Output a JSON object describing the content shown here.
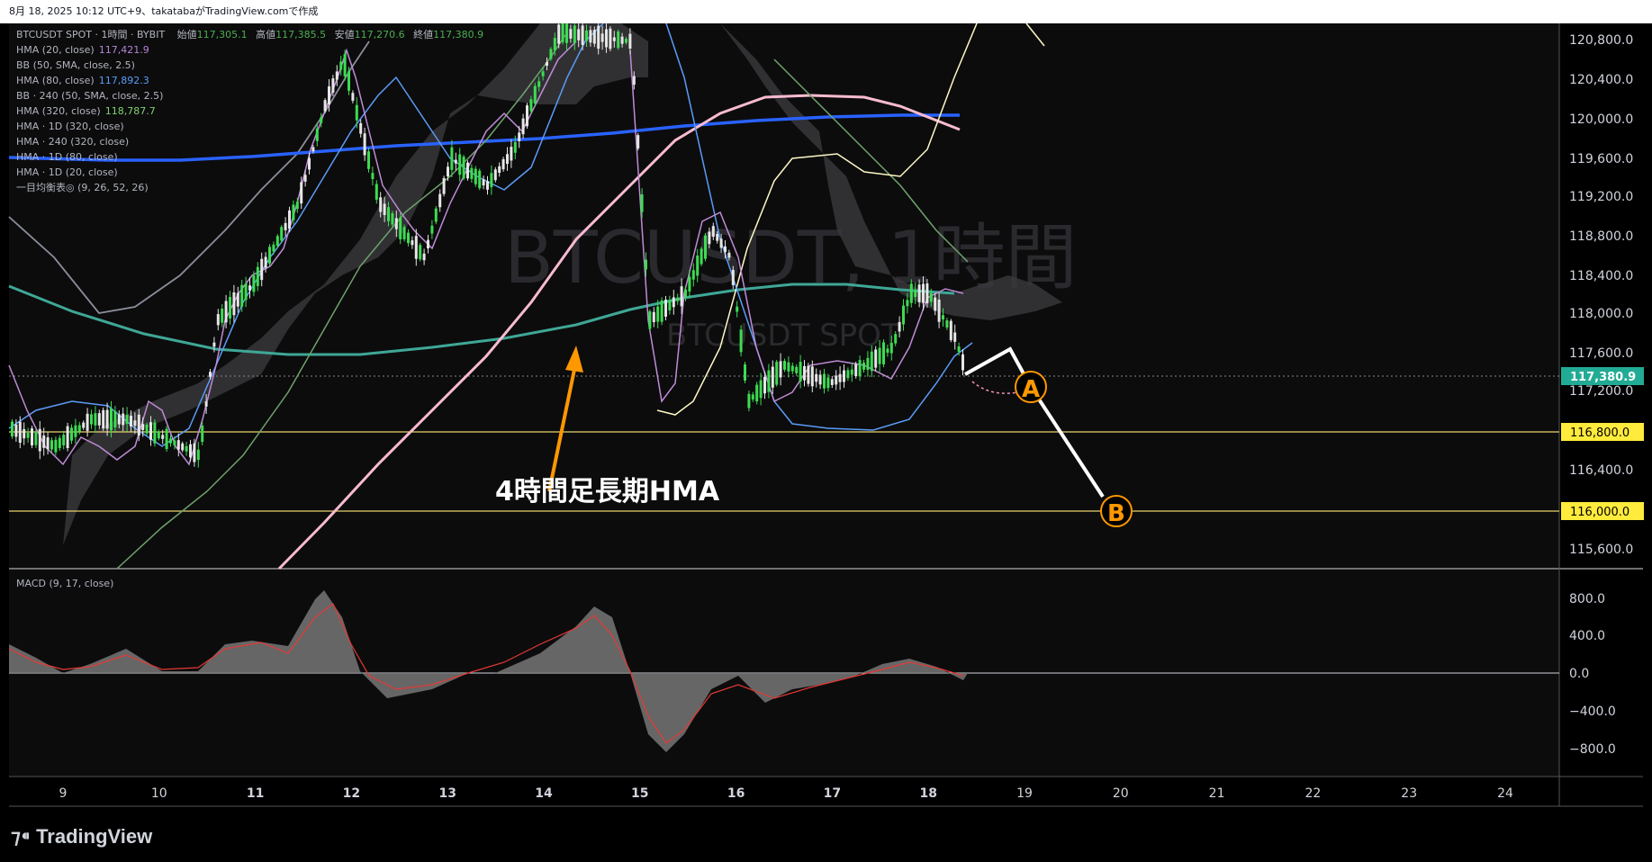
{
  "header": {
    "caption": "8月 18, 2025 10:12 UTC+9、takatabaがTradingView.comで作成"
  },
  "legend": {
    "symbol": "BTCUSDT SPOT · 1時間 · BYBIT",
    "ohlc": {
      "open_label": "始値",
      "open": "117,305.1",
      "high_label": "高値",
      "high": "117,385.5",
      "low_label": "安値",
      "low": "117,270.6",
      "close_label": "終値",
      "close": "117,380.9"
    },
    "indicators": [
      {
        "label": "HMA (20, close)",
        "value": "117,421.9",
        "color": "#b386d6"
      },
      {
        "label": "BB (50, SMA, close, 2.5)",
        "value": "",
        "color": ""
      },
      {
        "label": "HMA (80, close)",
        "value": "117,892.3",
        "color": "#5b9cf6"
      },
      {
        "label": "BB · 240 (50, SMA, close, 2.5)",
        "value": "",
        "color": ""
      },
      {
        "label": "HMA (320, close)",
        "value": "118,787.7",
        "color": "#7ed36e"
      },
      {
        "label": "HMA · 1D (320, close)",
        "value": "",
        "color": ""
      },
      {
        "label": "HMA · 240 (320, close)",
        "value": "",
        "color": ""
      },
      {
        "label": "HMA · 1D (80, close)",
        "value": "",
        "color": ""
      },
      {
        "label": "HMA · 1D (20, close)",
        "value": "",
        "color": ""
      },
      {
        "label": "一目均衡表◎ (9, 26, 52, 26)",
        "value": "",
        "color": ""
      }
    ]
  },
  "watermark": {
    "title": "BTCUSDT, 1時間",
    "subtitle": "BTCUSDT SPOT"
  },
  "annotation": {
    "text": "4時間足長期HMA",
    "wave_a": "A",
    "wave_b": "B"
  },
  "price_axis": {
    "ticks": [
      "120,800.0",
      "120,400.0",
      "120,000.0",
      "119,600.0",
      "119,200.0",
      "118,800.0",
      "118,400.0",
      "118,000.0",
      "117,600.0",
      "117,200.0",
      "116,400.0",
      "115,600.0"
    ],
    "current_price": "117,380.9",
    "level_1": "116,800.0",
    "level_2": "116,000.0",
    "colors": {
      "current_bg": "#22ab94",
      "level_bg": "#ffeb3b"
    }
  },
  "macd": {
    "label": "MACD (9, 17, close)",
    "ticks": [
      "800.0",
      "400.0",
      "0.0",
      "−400.0",
      "−800.0"
    ]
  },
  "time_axis": {
    "labels": [
      "9",
      "10",
      "11",
      "12",
      "13",
      "14",
      "15",
      "16",
      "17",
      "18",
      "19",
      "20",
      "21",
      "22",
      "23",
      "24"
    ]
  },
  "footer": {
    "brand": "TradingView"
  },
  "chart_data": {
    "type": "line",
    "title": "BTCUSDT SPOT · 1時間 · BYBIT",
    "ylim": [
      115400,
      121000
    ],
    "x_range": [
      "9",
      "24"
    ],
    "series": [
      {
        "name": "HMA (20, close)",
        "last": 117421.9
      },
      {
        "name": "HMA (80, close)",
        "last": 117892.3
      },
      {
        "name": "HMA (320, close)",
        "last": 118787.7
      }
    ],
    "horizontal_levels": [
      116800.0,
      116000.0
    ],
    "last_price": 117380.9,
    "projection": {
      "points": [
        "A",
        "B"
      ],
      "target": 116000.0
    }
  }
}
